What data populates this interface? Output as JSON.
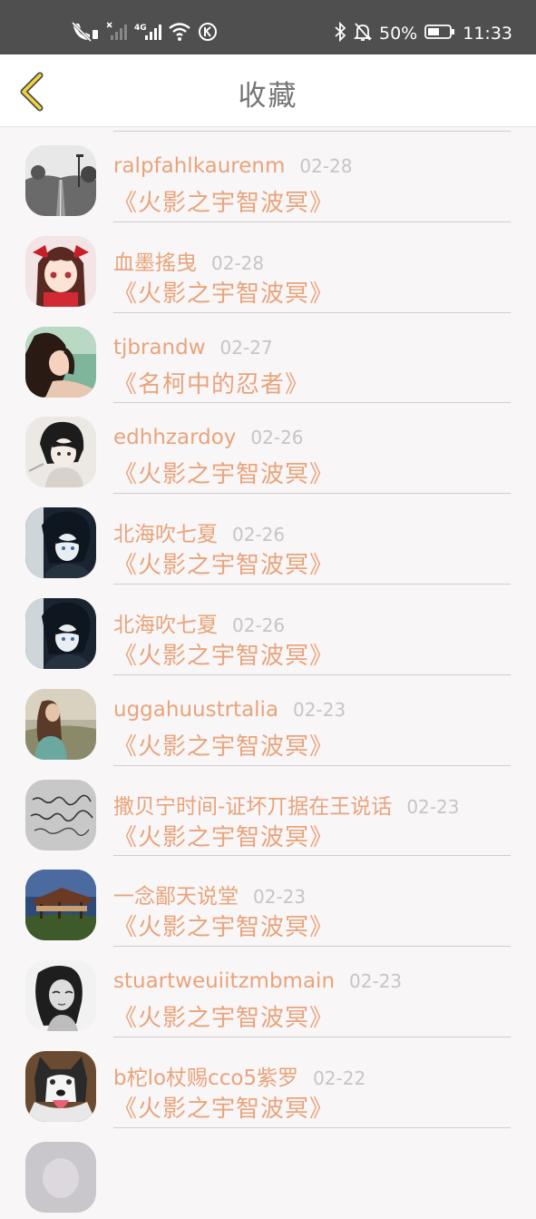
{
  "status_bar": {
    "battery": "50%",
    "time": "11:33",
    "network": "4G"
  },
  "header": {
    "title": "收藏"
  },
  "colors": {
    "accent": "#e8a47c",
    "date": "#c6c6c6",
    "back_icon": "#f0d53a"
  },
  "items": [
    {
      "user": "ralpfahlkaurenm",
      "date": "02-28",
      "title": "《火影之宇智波冥》",
      "avatar": "road-photo"
    },
    {
      "user": "血墨搖曳",
      "date": "02-28",
      "title": "《火影之宇智波冥》",
      "avatar": "anime-girl-red-bow"
    },
    {
      "user": "tjbrandw",
      "date": "02-27",
      "title": "《名柯中的忍者》",
      "avatar": "girl-photo"
    },
    {
      "user": "edhhzardoy",
      "date": "02-26",
      "title": "《火影之宇智波冥》",
      "avatar": "anime-boy-sketch"
    },
    {
      "user": "北海吹七夏",
      "date": "02-26",
      "title": "《火影之宇智波冥》",
      "avatar": "anime-boy-dark"
    },
    {
      "user": "北海吹七夏",
      "date": "02-26",
      "title": "《火影之宇智波冥》",
      "avatar": "anime-boy-dark"
    },
    {
      "user": "uggahuustrtalia",
      "date": "02-23",
      "title": "《火影之宇智波冥》",
      "avatar": "girl-field"
    },
    {
      "user": "撒贝宁时间-证坏丌据在王说话",
      "date": "02-23",
      "title": "《火影之宇智波冥》",
      "avatar": "handwriting"
    },
    {
      "user": "一念鄙天说堂",
      "date": "02-23",
      "title": "《火影之宇智波冥》",
      "avatar": "pavilion"
    },
    {
      "user": "stuartweuiitzmbmain",
      "date": "02-23",
      "title": "《火影之宇智波冥》",
      "avatar": "bw-girl"
    },
    {
      "user": "b柁lo杖赐cco5紫罗",
      "date": "02-22",
      "title": "《火影之宇智波冥》",
      "avatar": "husky"
    },
    {
      "user": "",
      "date": "",
      "title": "",
      "avatar": "partial"
    }
  ]
}
